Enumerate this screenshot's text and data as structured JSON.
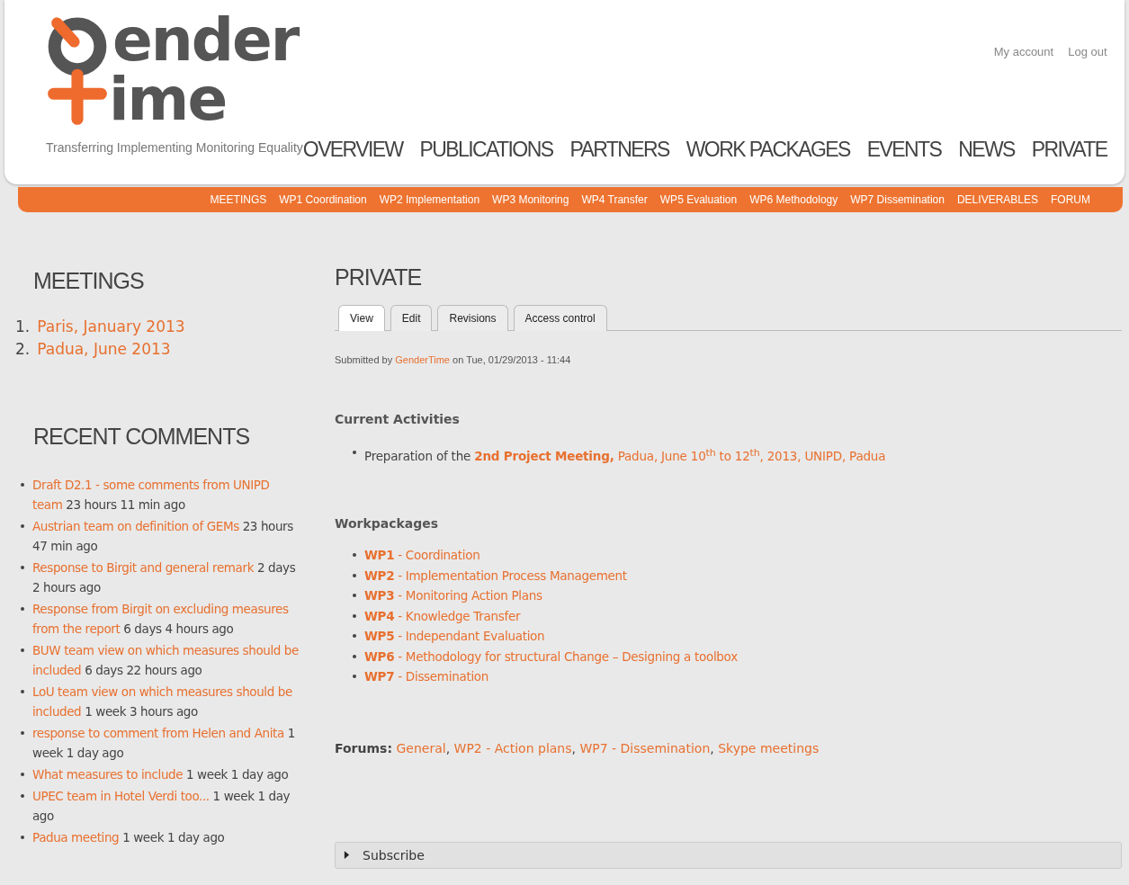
{
  "logo": {
    "line1": "ender",
    "line2": "ime",
    "tagline": "Transferring Implementing Monitoring Equality"
  },
  "user_links": [
    "My account",
    "Log out"
  ],
  "main_nav": [
    "OVERVIEW",
    "PUBLICATIONS",
    "PARTNERS",
    "WORK PACKAGES",
    "EVENTS",
    "NEWS",
    "PRIVATE"
  ],
  "sub_nav": [
    "MEETINGS",
    "WP1 Coordination",
    "WP2 Implementation",
    "WP3 Monitoring",
    "WP4 Transfer",
    "WP5 Evaluation",
    "WP6 Methodology",
    "WP7 Dissemination",
    "DELIVERABLES",
    "FORUM"
  ],
  "sidebar": {
    "meetings": {
      "title": "MEETINGS",
      "items": [
        {
          "number": "1.",
          "text": "Paris, January 2013"
        },
        {
          "number": "2.",
          "text": "Padua, June 2013"
        }
      ]
    },
    "recent_comments": {
      "title": "RECENT COMMENTS",
      "items": [
        {
          "title": "Draft D2.1 - some comments from UNIPD team",
          "time": "23 hours 11 min ago"
        },
        {
          "title": "Austrian team on definition of GEMs",
          "time": "23 hours 47 min ago"
        },
        {
          "title": "Response to Birgit and general remark",
          "time": "2 days 2 hours ago"
        },
        {
          "title": "Response from Birgit on excluding measures from the report",
          "time": "6 days 4 hours ago"
        },
        {
          "title": "BUW team view on which measures should be included",
          "time": "6 days 22 hours ago"
        },
        {
          "title": "LoU team view on which measures should be included",
          "time": "1 week 3 hours ago"
        },
        {
          "title": "response to comment from Helen and Anita",
          "time": "1 week 1 day ago"
        },
        {
          "title": "What measures to include",
          "time": "1 week 1 day ago"
        },
        {
          "title": "UPEC team in Hotel Verdi too...",
          "time": "1 week 1 day ago"
        },
        {
          "title": "Padua meeting",
          "time": "1 week 1 day ago"
        }
      ]
    }
  },
  "content": {
    "title": "PRIVATE",
    "tabs": [
      {
        "label": "View",
        "selected": true
      },
      {
        "label": "Edit",
        "selected": false
      },
      {
        "label": "Revisions",
        "selected": false
      },
      {
        "label": "Access control",
        "selected": false
      }
    ],
    "submitted": {
      "prefix": "Submitted by",
      "author": "GenderTime",
      "suffix": "on Tue, 01/29/2013 - 11:44"
    },
    "current_activities": {
      "heading": "Current Activities",
      "items": [
        {
          "prefix": "Preparation of the",
          "link": "**2nd Project Meeting,** Padua, June 10$^{th}$ to 12$^{th}$, 2013, UNIPD, Padua"
        }
      ]
    },
    "workpackages": {
      "heading": "Workpackages",
      "items": [
        "**WP1** - Coordination",
        "**WP2** - Implementation Process Management",
        "**WP3** - Monitoring Action Plans",
        "**WP4** - Knowledge Transfer",
        "**WP5** - Independant Evaluation",
        "**WP6** - Methodology for structural Change – Designing a toolbox",
        "**WP7** - Dissemination"
      ]
    },
    "forums": {
      "label": "Forums:",
      "links": [
        {
          "text": "General",
          "sep": ","
        },
        {
          "text": "WP2 - Action plans",
          "sep": ","
        },
        {
          "text": "WP7 - Dissemination",
          "sep": ","
        },
        {
          "text": "Skype meetings"
        }
      ]
    },
    "subscribe": {
      "label": "Subscribe",
      "expanded": false
    }
  }
}
